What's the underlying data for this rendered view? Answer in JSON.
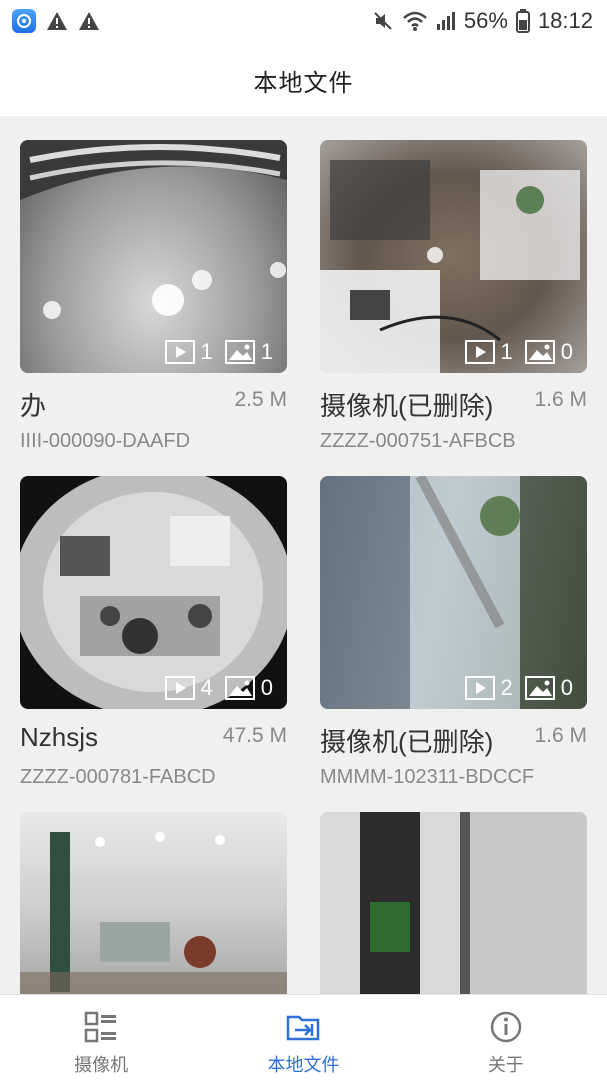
{
  "status_bar": {
    "battery": "56%",
    "time": "18:12",
    "icons": [
      "camera-app-icon",
      "warning-icon",
      "warning-icon",
      "mute-icon",
      "wifi-icon",
      "signal-icon",
      "battery-icon"
    ]
  },
  "header": {
    "title": "本地文件"
  },
  "files": [
    {
      "name": "办",
      "size": "2.5 M",
      "device_id": "IIII-000090-DAAFD",
      "videos": "1",
      "images": "1"
    },
    {
      "name": "摄像机(已删除)",
      "size": "1.6 M",
      "device_id": "ZZZZ-000751-AFBCB",
      "videos": "1",
      "images": "0"
    },
    {
      "name": "Nzhsjs",
      "size": "47.5 M",
      "device_id": "ZZZZ-000781-FABCD",
      "videos": "4",
      "images": "0"
    },
    {
      "name": "摄像机(已删除)",
      "size": "1.6 M",
      "device_id": "MMMM-102311-BDCCF",
      "videos": "2",
      "images": "0"
    },
    {
      "name": "",
      "size": "",
      "device_id": "",
      "videos": "",
      "images": ""
    },
    {
      "name": "",
      "size": "",
      "device_id": "",
      "videos": "",
      "images": ""
    }
  ],
  "bottom_nav": [
    {
      "label": "摄像机",
      "icon": "camera-list-icon",
      "active": false
    },
    {
      "label": "本地文件",
      "icon": "folder-icon",
      "active": true
    },
    {
      "label": "关于",
      "icon": "info-icon",
      "active": false
    }
  ],
  "colors": {
    "accent": "#2f6fd6",
    "inactive": "#777777"
  }
}
